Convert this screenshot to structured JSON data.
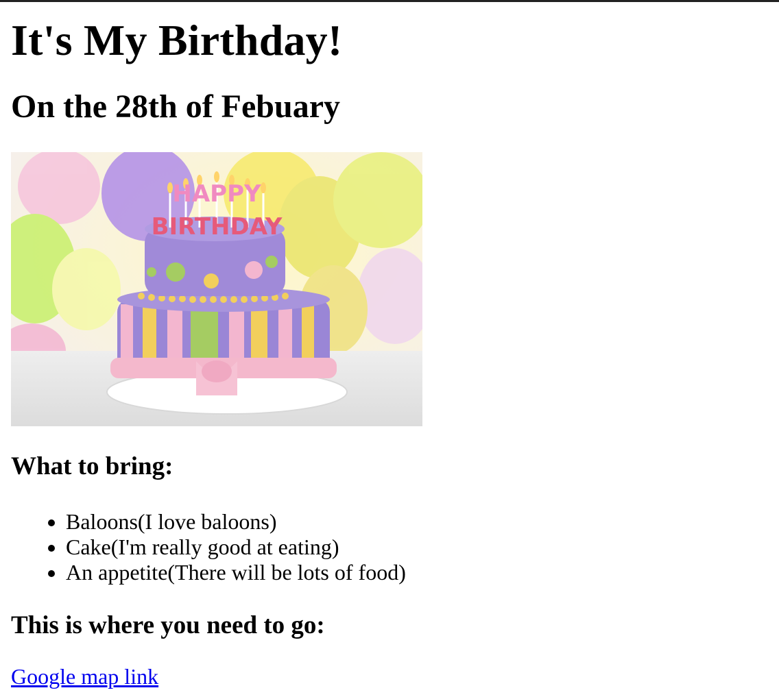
{
  "page": {
    "title": "It's My Birthday!",
    "subtitle": "On the 28th of Febuary",
    "hero_image": {
      "alt": "Birthday cake",
      "cake_text_line1": "HAPPY",
      "cake_text_line2": "BIRTHDAY"
    },
    "bring_heading": "What to bring:",
    "bring_items": [
      "Baloons(I love baloons)",
      "Cake(I'm really good at eating)",
      "An appetite(There will be lots of food)"
    ],
    "go_heading": "This is where you need to go:",
    "map_link_label": "Google map link"
  },
  "colors": {
    "link": "#0000ee",
    "text": "#000000",
    "background": "#ffffff",
    "cake_purple": "#9a86d6",
    "cake_pink": "#f3b6cf",
    "cake_yellow": "#f2cf5c",
    "cake_green": "#a5cc62"
  }
}
